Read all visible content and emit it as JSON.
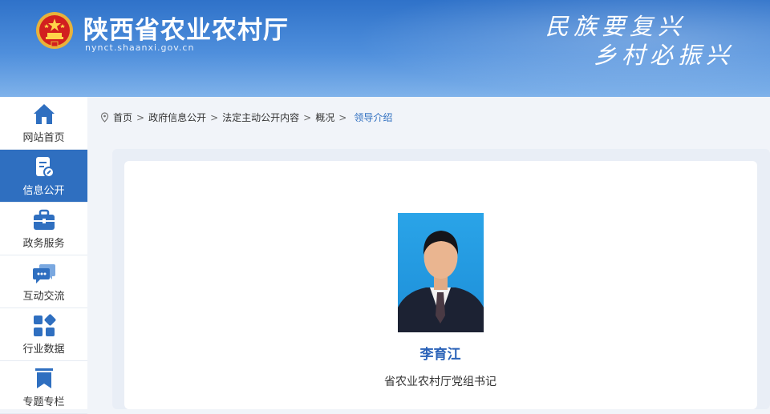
{
  "header": {
    "title": "陕西省农业农村厅",
    "domain": "nynct.shaanxi.gov.cn",
    "slogan_line1": "民族要复兴",
    "slogan_line2": "乡村必振兴",
    "colors": {
      "top": "#2f72c9",
      "bottom": "#7fb2ea"
    }
  },
  "sidebar": {
    "items": [
      {
        "label": "网站首页",
        "icon": "home-icon",
        "active": false
      },
      {
        "label": "信息公开",
        "icon": "document-icon",
        "active": true
      },
      {
        "label": "政务服务",
        "icon": "briefcase-icon",
        "active": false
      },
      {
        "label": "互动交流",
        "icon": "chat-icon",
        "active": false
      },
      {
        "label": "行业数据",
        "icon": "data-grid-icon",
        "active": false
      },
      {
        "label": "专题专栏",
        "icon": "bookmark-icon",
        "active": false
      }
    ],
    "active_color": "#2f6fc0"
  },
  "breadcrumb": {
    "icon": "location-icon",
    "items": [
      "首页",
      "政府信息公开",
      "法定主动公开内容",
      "概况"
    ],
    "separator": ">",
    "current": "领导介绍"
  },
  "leader": {
    "name": "李育江",
    "position": "省农业农村厅党组书记"
  }
}
